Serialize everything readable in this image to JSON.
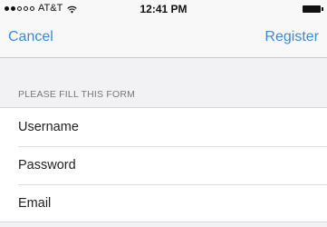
{
  "status_bar": {
    "carrier": "AT&T",
    "time": "12:41 PM",
    "signal_bars": 2,
    "signal_total": 5
  },
  "nav": {
    "cancel_label": "Cancel",
    "register_label": "Register",
    "accent_color": "#3a8ad8"
  },
  "form": {
    "section_header": "PLEASE FILL THIS FORM",
    "fields": [
      {
        "label": "Username"
      },
      {
        "label": "Password"
      },
      {
        "label": "Email"
      }
    ]
  }
}
